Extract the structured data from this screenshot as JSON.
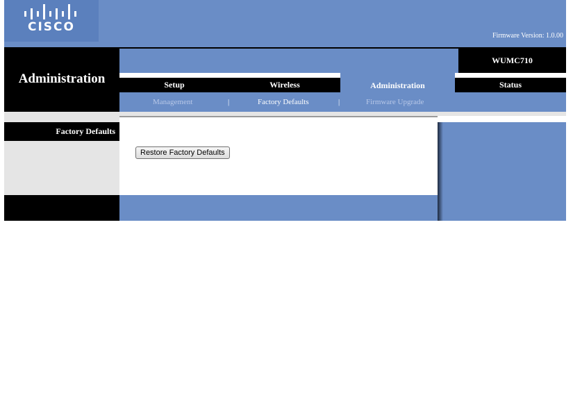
{
  "brand": {
    "logo_text": "CISCO",
    "firmware_label": "Firmware Version:  1.0.00",
    "icon": "cisco-logo-bars"
  },
  "header": {
    "section_title": "Administration",
    "model": "WUMC710"
  },
  "tabs": [
    {
      "label": "Setup",
      "active": false
    },
    {
      "label": "Wireless",
      "active": false
    },
    {
      "label": "Administration",
      "active": true
    },
    {
      "label": "Status",
      "active": false
    }
  ],
  "subtabs": [
    {
      "label": "Management",
      "active": false
    },
    {
      "label": "Factory Defaults",
      "active": true
    },
    {
      "label": "Firmware Upgrade",
      "active": false
    }
  ],
  "separator": "|",
  "sidebar": {
    "label": "Factory Defaults"
  },
  "main": {
    "restore_button": "Restore Factory Defaults"
  },
  "colors": {
    "blue": "#6a8dc6",
    "black": "#000000",
    "gray": "#e5e5e5"
  }
}
